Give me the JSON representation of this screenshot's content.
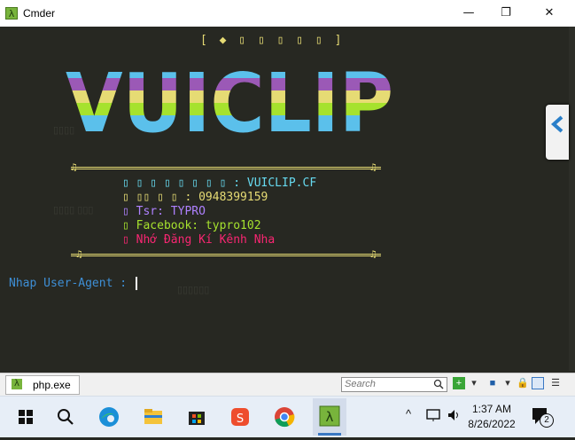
{
  "window": {
    "title": "Cmder",
    "minimize_glyph": "—",
    "maximize_glyph": "❐",
    "close_glyph": "✕",
    "app_icon_glyph": "λ"
  },
  "terminal": {
    "banner_top": "[ ◆ ▯ ▯ ▯  ▯ ▯ ]",
    "logo_text": "VUICLIP",
    "logo_colors": [
      "#5bc0eb",
      "#9b59b6",
      "#e6db74",
      "#a6e22e"
    ],
    "frame_glyph": "♫",
    "info": [
      {
        "text": "▯ ▯ ▯ ▯ ▯ ▯ ▯ ▯ : VUICLIP.CF",
        "color": "#66d9ef"
      },
      {
        "text": "▯ ▯▯ ▯ ▯ : 0948399159",
        "color": "#e6db74"
      },
      {
        "text": "▯ Tsr: TYPRO",
        "color": "#ae81ff"
      },
      {
        "text": "▯ Facebook: typro102",
        "color": "#a6e22e"
      },
      {
        "text": "▯ Nhớ Đăng Kí Kênh Nha",
        "color": "#f92672"
      }
    ],
    "prompt": "Nhap User-Agent : "
  },
  "tabbar": {
    "tab_label": "php.exe",
    "tab_icon_glyph": "λ",
    "search_placeholder": "Search",
    "search_icon": "magnifier-icon"
  },
  "taskbar": {
    "time": "1:37 AM",
    "date": "8/26/2022",
    "notification_count": "2",
    "tray_chevron": "^"
  }
}
